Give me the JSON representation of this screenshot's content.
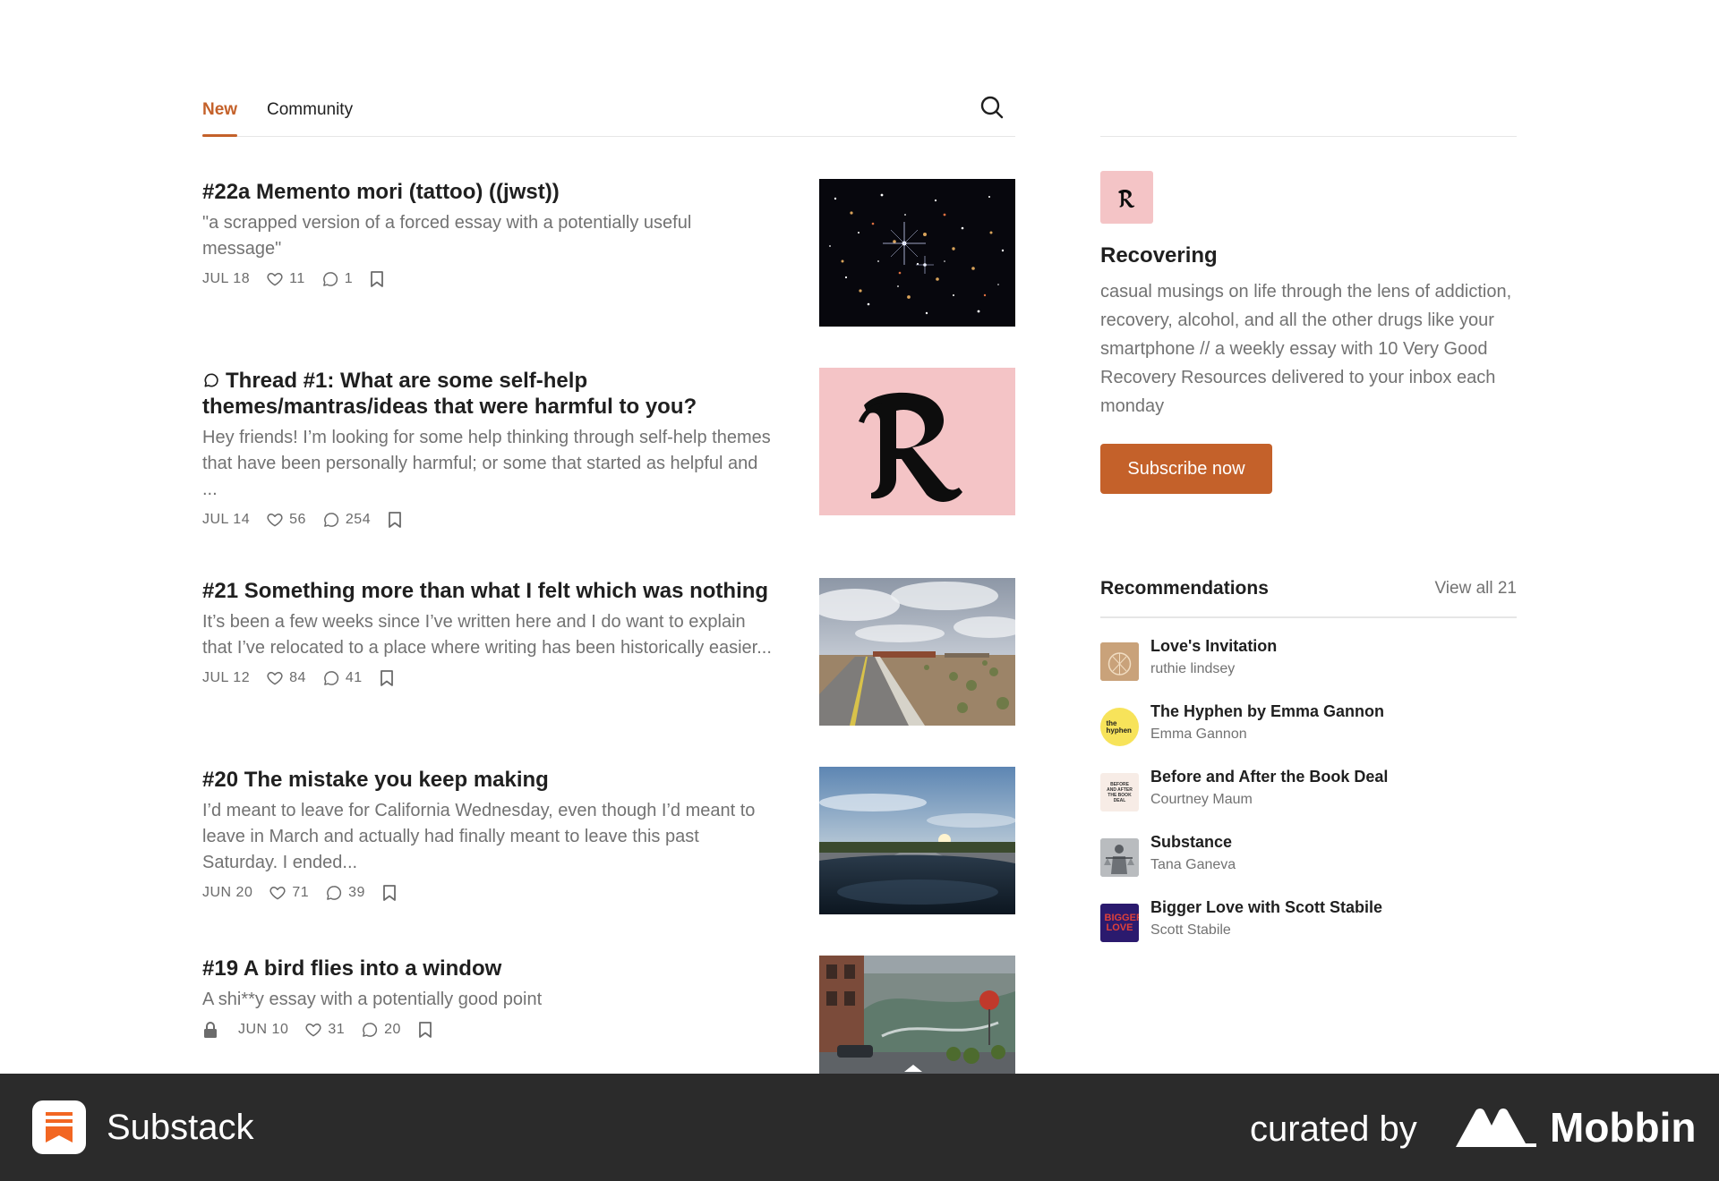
{
  "tabs": [
    {
      "label": "New",
      "active": true
    },
    {
      "label": "Community",
      "active": false
    }
  ],
  "posts": [
    {
      "title": "#22a Memento mori (tattoo) ((jwst))",
      "subtitle": "\"a scrapped version of a forced essay with a potentially useful message\"",
      "date": "JUL 18",
      "likes": "11",
      "comments": "1",
      "thread": false,
      "locked": false,
      "image": "space"
    },
    {
      "title": "Thread #1: What are some self-help themes/mantras/ideas that were harmful to you?",
      "subtitle": "Hey friends! I’m looking for some help thinking through self-help themes that have been personally harmful; or some that started as helpful and ...",
      "date": "JUL 14",
      "likes": "56",
      "comments": "254",
      "thread": true,
      "locked": false,
      "image": "logo"
    },
    {
      "title": "#21 Something more than what I felt which was nothing",
      "subtitle": "It’s been a few weeks since I’ve written here and I do want to explain that I’ve relocated to a place where writing has been historically easier...",
      "date": "JUL 12",
      "likes": "84",
      "comments": "41",
      "thread": false,
      "locked": false,
      "image": "desert-road"
    },
    {
      "title": "#20 The mistake you keep making",
      "subtitle": "I’d meant to leave for California Wednesday, even though I’d meant to leave in March and actually had finally meant to leave this past Saturday. I ended...",
      "date": "JUN 20",
      "likes": "71",
      "comments": "39",
      "thread": false,
      "locked": false,
      "image": "highway-sunset"
    },
    {
      "title": "#19 A bird flies into a window",
      "subtitle": "A shi**y essay with a potentially good point",
      "date": "JUN 10",
      "likes": "31",
      "comments": "20",
      "thread": false,
      "locked": true,
      "image": "street-mural"
    }
  ],
  "publication": {
    "logo_letter": "R",
    "name": "Recovering",
    "description": "casual musings on life through the lens of addiction, recovery, alcohol, and all the other drugs like your smartphone // a weekly essay with 10 Very Good Recovery Resources delivered to your inbox each monday",
    "subscribe_label": "Subscribe now"
  },
  "recommendations": {
    "title": "Recommendations",
    "view_all": "View all 21",
    "items": [
      {
        "name": "Love's Invitation",
        "author": "ruthie lindsey",
        "icon": "loves-invitation-logo"
      },
      {
        "name": "The Hyphen by Emma Gannon",
        "author": "Emma Gannon",
        "icon": "hyphen-logo",
        "icon_text": "the hyphen"
      },
      {
        "name": "Before and After the Book Deal",
        "author": "Courtney Maum",
        "icon": "book-deal-logo",
        "icon_text": "BEFORE AND AFTER THE BOOK DEAL"
      },
      {
        "name": "Substance",
        "author": "Tana Ganeva",
        "icon": "substance-logo"
      },
      {
        "name": "Bigger Love with Scott Stabile",
        "author": "Scott Stabile",
        "icon": "bigger-love-logo",
        "icon_text": "BIGGER LOVE"
      }
    ]
  },
  "footer": {
    "app_name": "Substack",
    "curated_by": "curated by",
    "brand": "Mobbin"
  },
  "colors": {
    "accent": "#c4612a",
    "footer_bg": "#2b2b2b",
    "logo_pink": "#f4c4c6"
  }
}
